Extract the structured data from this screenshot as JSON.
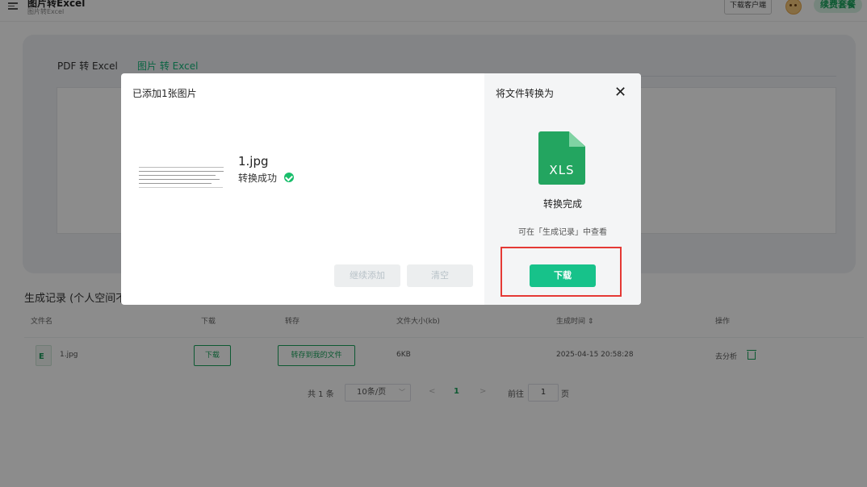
{
  "header": {
    "title": "图片转Excel",
    "subtitle": "图片转Excel",
    "download_client": "下载客户端",
    "renew": "续费套餐"
  },
  "tabs": [
    {
      "label": "PDF 转 Excel",
      "active": false
    },
    {
      "label": "图片 转 Excel",
      "active": true
    }
  ],
  "records": {
    "title": "生成记录 (个人空间不",
    "columns": [
      "文件名",
      "下载",
      "转存",
      "文件大小(kb)",
      "生成时间 ⇕",
      "操作"
    ],
    "rows": [
      {
        "file": "1.jpg",
        "file_icon_letter": "E",
        "download": "下载",
        "save": "转存到我的文件",
        "size": "6KB",
        "time": "2025-04-15 20:58:28",
        "analyze": "去分析"
      }
    ]
  },
  "pagination": {
    "total": "共 1 条",
    "page_size": "10条/页",
    "prev": "<",
    "current": "1",
    "next": ">",
    "goto_prefix": "前往",
    "goto_value": "1",
    "goto_suffix": "页"
  },
  "modal": {
    "added_title": "已添加1张图片",
    "file_name": "1.jpg",
    "status": "转换成功",
    "continue_add": "继续添加",
    "clear": "清空",
    "convert_title": "将文件转换为",
    "close": "✕",
    "format": "XLS",
    "done": "转换完成",
    "hint": "可在「生成记录」中查看",
    "download": "下载"
  },
  "colors": {
    "accent": "#17c28a",
    "highlight": "#e53935"
  }
}
